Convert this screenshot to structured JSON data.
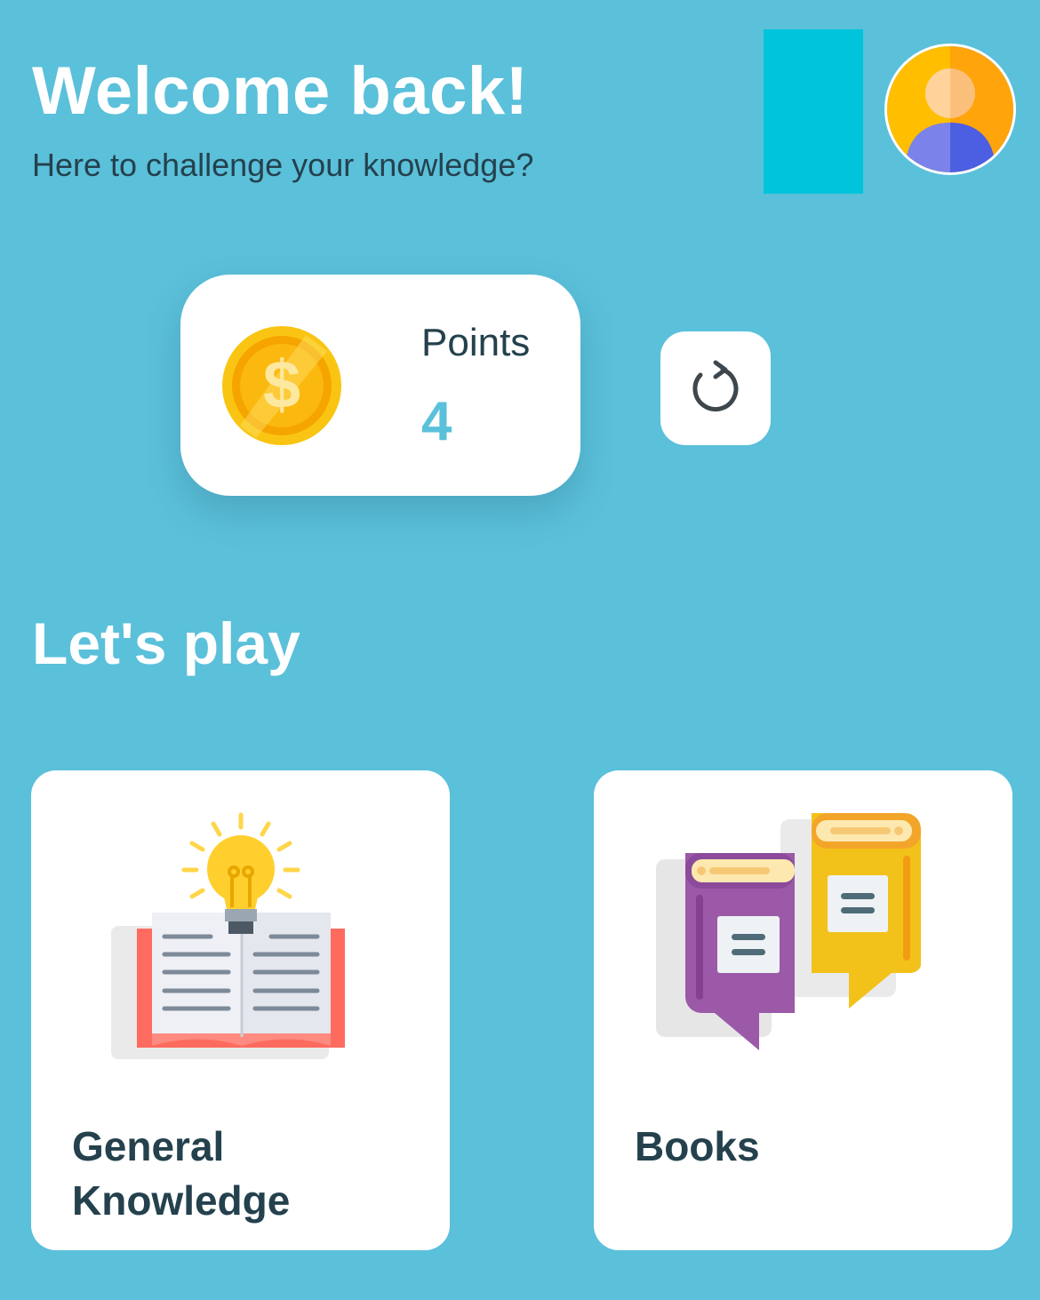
{
  "header": {
    "title": "Welcome back!",
    "subtitle": "Here to challenge your knowledge?",
    "avatar_icon": "user-avatar-icon"
  },
  "points": {
    "label": "Points",
    "value": "4",
    "coin_icon": "dollar-coin-icon",
    "refresh_icon": "refresh-icon"
  },
  "section": {
    "title": "Let's play"
  },
  "categories": [
    {
      "label": "General Knowledge",
      "icon": "lightbulb-book-icon"
    },
    {
      "label": "Books",
      "icon": "books-icon"
    }
  ],
  "colors": {
    "background": "#5bc0da",
    "accent": "#00c4dc",
    "text_dark": "#24414d",
    "card": "#ffffff"
  }
}
